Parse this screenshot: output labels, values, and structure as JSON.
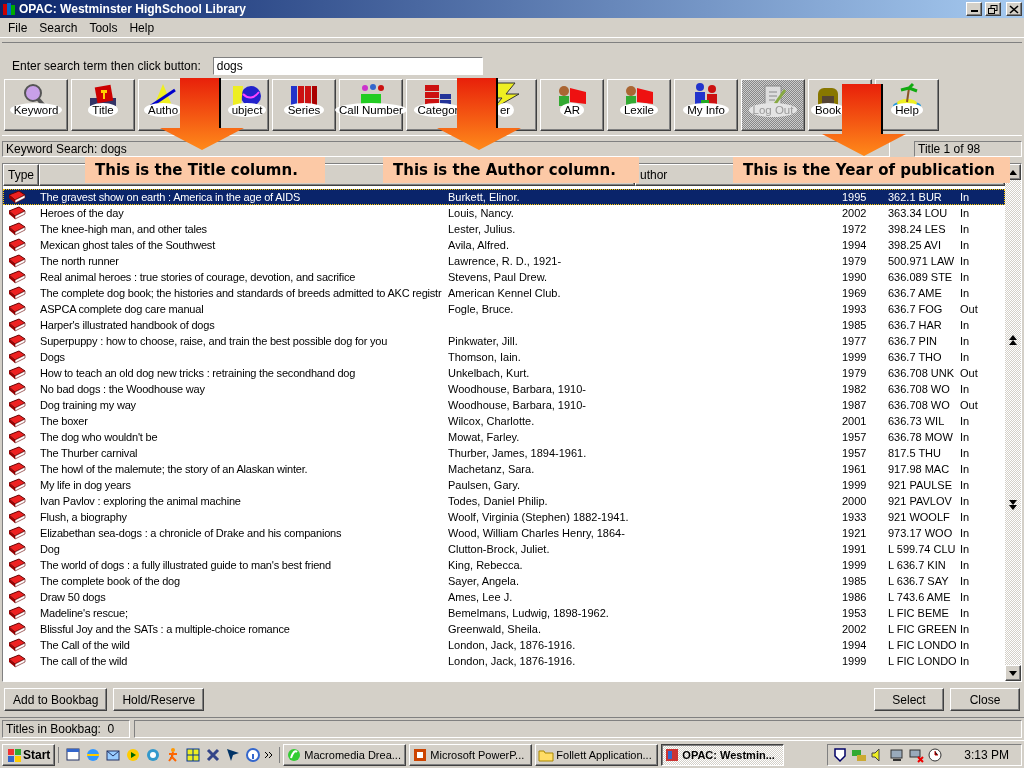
{
  "window": {
    "title": "OPAC: Westminster HighSchool Library"
  },
  "menu": [
    "File",
    "Search",
    "Tools",
    "Help"
  ],
  "search": {
    "label": "Enter search term then click button:",
    "value": "dogs"
  },
  "toolbar": [
    {
      "label": "Keyword",
      "disabled": false
    },
    {
      "label": "Title",
      "disabled": false
    },
    {
      "label": "Autho",
      "disabled": false
    },
    {
      "label": "ubject",
      "disabled": false
    },
    {
      "label": "Series",
      "disabled": false
    },
    {
      "label": "Call Number",
      "disabled": false
    },
    {
      "label": "Categor",
      "disabled": false
    },
    {
      "label": "er",
      "disabled": false
    },
    {
      "label": "AR",
      "disabled": false
    },
    {
      "label": "Lexile",
      "disabled": false
    },
    {
      "label": "My Info",
      "disabled": false
    },
    {
      "label": "Log Out",
      "disabled": true
    },
    {
      "label": "Book",
      "disabled": false
    },
    {
      "label": "Help",
      "disabled": false
    }
  ],
  "search_status": "Keyword Search: dogs",
  "position": "Title 1 of 98",
  "table": {
    "columns": [
      "Type",
      "uthor"
    ],
    "rows": [
      {
        "title": "The gravest show on earth : America in the age of AIDS",
        "author": "Burkett, Elinor.",
        "year": "1995",
        "call_number": "362.1 BUR",
        "status": "In",
        "selected": true
      },
      {
        "title": "Heroes of the day",
        "author": "Louis, Nancy.",
        "year": "2002",
        "call_number": "363.34 LOU",
        "status": "In",
        "selected": false
      },
      {
        "title": "The knee-high man, and other tales",
        "author": "Lester, Julius.",
        "year": "1972",
        "call_number": "398.24 LES",
        "status": "In",
        "selected": false
      },
      {
        "title": "Mexican ghost tales of the Southwest",
        "author": "Avila, Alfred.",
        "year": "1994",
        "call_number": "398.25 AVI",
        "status": "In",
        "selected": false
      },
      {
        "title": "The north runner",
        "author": "Lawrence, R. D., 1921-",
        "year": "1979",
        "call_number": "500.971 LAW",
        "status": "In",
        "selected": false
      },
      {
        "title": "Real animal heroes : true stories of courage, devotion, and sacrifice",
        "author": "Stevens, Paul Drew.",
        "year": "1990",
        "call_number": "636.089 STE",
        "status": "In",
        "selected": false
      },
      {
        "title": "The complete dog book; the histories and standards of breeds admitted to AKC registr",
        "author": "American Kennel Club.",
        "year": "1969",
        "call_number": "636.7 AME",
        "status": "In",
        "selected": false
      },
      {
        "title": "ASPCA complete dog care manual",
        "author": "Fogle, Bruce.",
        "year": "1993",
        "call_number": "636.7 FOG",
        "status": "Out",
        "selected": false
      },
      {
        "title": "Harper's illustrated handbook of dogs",
        "author": "",
        "year": "1985",
        "call_number": "636.7 HAR",
        "status": "In",
        "selected": false
      },
      {
        "title": "Superpuppy : how to choose, raise, and train the best possible dog for you",
        "author": "Pinkwater, Jill.",
        "year": "1977",
        "call_number": "636.7 PIN",
        "status": "In",
        "selected": false
      },
      {
        "title": "Dogs",
        "author": "Thomson, Iain.",
        "year": "1999",
        "call_number": "636.7 THO",
        "status": "In",
        "selected": false
      },
      {
        "title": "How to teach an old dog new tricks : retraining the secondhand dog",
        "author": "Unkelbach, Kurt.",
        "year": "1979",
        "call_number": "636.708 UNK",
        "status": "Out",
        "selected": false
      },
      {
        "title": "No bad dogs : the Woodhouse way",
        "author": "Woodhouse, Barbara, 1910-",
        "year": "1982",
        "call_number": "636.708 WO",
        "status": "In",
        "selected": false
      },
      {
        "title": "Dog training my way",
        "author": "Woodhouse, Barbara, 1910-",
        "year": "1987",
        "call_number": "636.708 WO",
        "status": "Out",
        "selected": false
      },
      {
        "title": "The boxer",
        "author": "Wilcox, Charlotte.",
        "year": "2001",
        "call_number": "636.73 WIL",
        "status": "In",
        "selected": false
      },
      {
        "title": "The dog who wouldn't be",
        "author": "Mowat, Farley.",
        "year": "1957",
        "call_number": "636.78 MOW",
        "status": "In",
        "selected": false
      },
      {
        "title": "The Thurber carnival",
        "author": "Thurber, James, 1894-1961.",
        "year": "1957",
        "call_number": "817.5 THU",
        "status": "In",
        "selected": false
      },
      {
        "title": "The howl of the malemute; the story of an Alaskan winter.",
        "author": "Machetanz, Sara.",
        "year": "1961",
        "call_number": "917.98 MAC",
        "status": "In",
        "selected": false
      },
      {
        "title": "My life in dog years",
        "author": "Paulsen, Gary.",
        "year": "1999",
        "call_number": "921 PAULSE",
        "status": "In",
        "selected": false
      },
      {
        "title": "Ivan Pavlov : exploring the animal machine",
        "author": "Todes, Daniel Philip.",
        "year": "2000",
        "call_number": "921 PAVLOV",
        "status": "In",
        "selected": false
      },
      {
        "title": "Flush, a biography",
        "author": "Woolf, Virginia (Stephen) 1882-1941.",
        "year": "1933",
        "call_number": "921 WOOLF",
        "status": "In",
        "selected": false
      },
      {
        "title": "Elizabethan sea-dogs : a chronicle of Drake and his companions",
        "author": "Wood, William Charles Henry, 1864-",
        "year": "1921",
        "call_number": "973.17 WOO",
        "status": "In",
        "selected": false
      },
      {
        "title": "Dog",
        "author": "Clutton-Brock, Juliet.",
        "year": "1991",
        "call_number": "L 599.74 CLU",
        "status": "In",
        "selected": false
      },
      {
        "title": "The world of dogs : a fully illustrated guide to man's best friend",
        "author": "King, Rebecca.",
        "year": "1999",
        "call_number": "L 636.7 KIN",
        "status": "In",
        "selected": false
      },
      {
        "title": "The complete book of the dog",
        "author": "Sayer, Angela.",
        "year": "1985",
        "call_number": "L 636.7 SAY",
        "status": "In",
        "selected": false
      },
      {
        "title": "Draw 50 dogs",
        "author": "Ames, Lee J.",
        "year": "1986",
        "call_number": "L 743.6 AME",
        "status": "In",
        "selected": false
      },
      {
        "title": "Madeline's rescue;",
        "author": "Bemelmans, Ludwig, 1898-1962.",
        "year": "1953",
        "call_number": "L FIC  BEME",
        "status": "In",
        "selected": false
      },
      {
        "title": "Blissful Joy and the SATs : a multiple-choice romance",
        "author": "Greenwald, Sheila.",
        "year": "2002",
        "call_number": "L FIC GREEN",
        "status": "In",
        "selected": false
      },
      {
        "title": "The Call of the wild",
        "author": "London, Jack, 1876-1916.",
        "year": "1994",
        "call_number": "L FIC LONDO",
        "status": "In",
        "selected": false
      },
      {
        "title": "The call of the wild",
        "author": "London, Jack, 1876-1916.",
        "year": "1999",
        "call_number": "L FIC LONDO",
        "status": "In",
        "selected": false
      }
    ]
  },
  "buttons_left": [
    "Add to Bookbag",
    "Hold/Reserve"
  ],
  "buttons_right": [
    "Select",
    "Close"
  ],
  "status_bar": "Titles in Bookbag:  0",
  "callouts": [
    "This is the Title column.",
    "This is the Author column.",
    "This is the Year of publication"
  ],
  "taskbar": {
    "start": "Start",
    "tasks": [
      {
        "label": "Macromedia Drea...",
        "selected": false
      },
      {
        "label": "Microsoft PowerP...",
        "selected": false
      },
      {
        "label": "Follett Application...",
        "selected": false
      },
      {
        "label": "OPAC: Westmin...",
        "selected": true
      }
    ],
    "clock": "3:13 PM"
  }
}
